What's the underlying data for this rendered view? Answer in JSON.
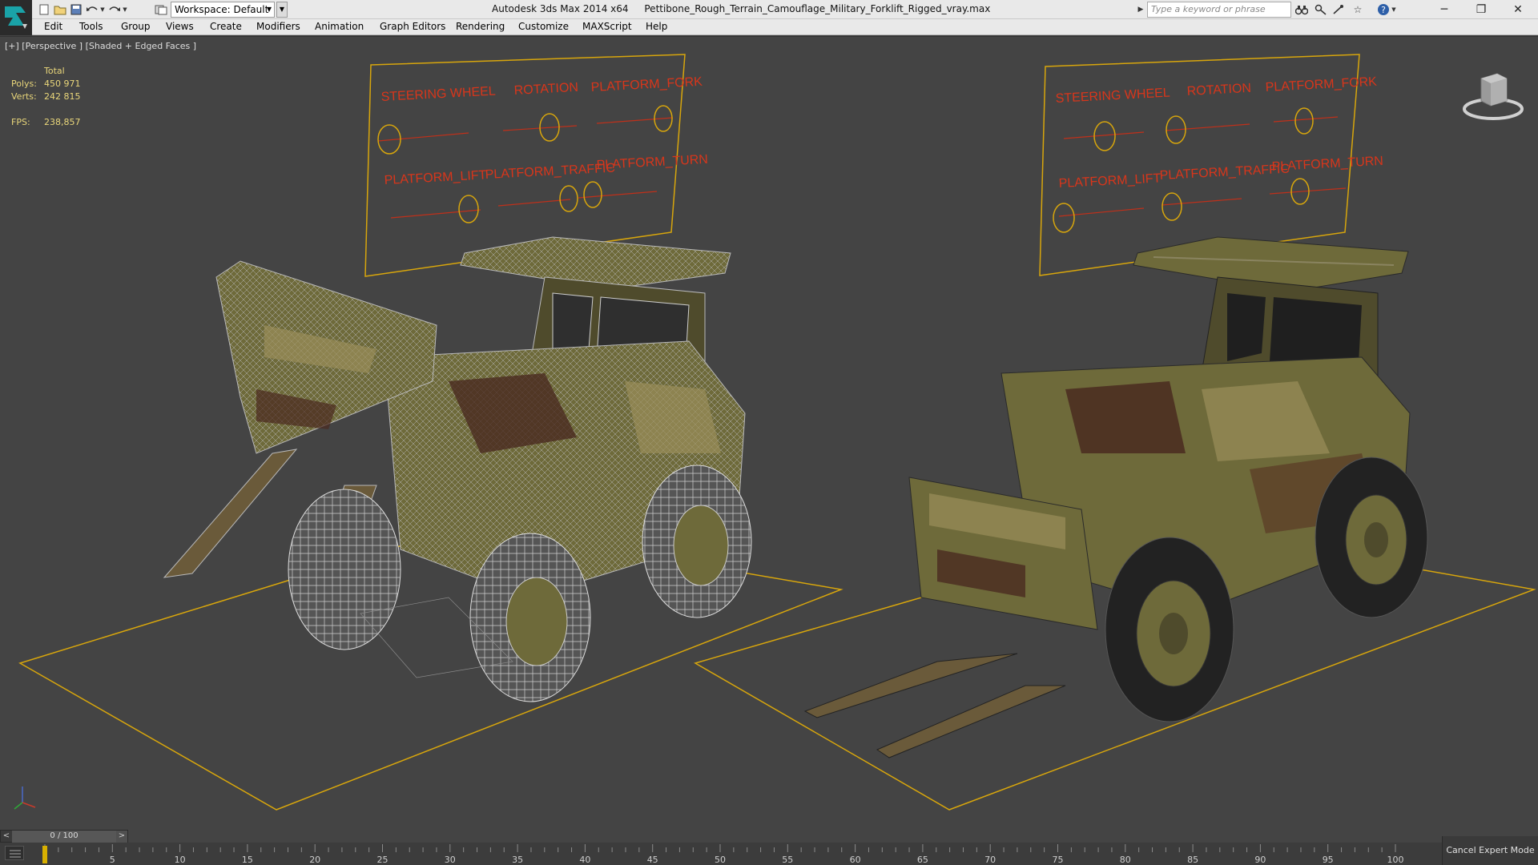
{
  "titlebar": {
    "workspace_label": "Workspace: Default",
    "app_name": "Autodesk 3ds Max  2014 x64",
    "file_name": "Pettibone_Rough_Terrain_Camouflage_Military_Forklift_Rigged_vray.max",
    "search_placeholder": "Type a keyword or phrase",
    "icons": [
      "new-icon",
      "open-icon",
      "save-icon",
      "undo-icon",
      "redo-icon",
      "project-icon",
      "binoculars-icon",
      "key-icon",
      "user-icon",
      "star-icon",
      "help-icon"
    ],
    "window_buttons": [
      "─",
      "❐",
      "✕"
    ]
  },
  "menu": {
    "items": [
      "Edit",
      "Tools",
      "Group",
      "Views",
      "Create",
      "Modifiers",
      "Animation",
      "Graph Editors",
      "Rendering",
      "Customize",
      "MAXScript",
      "Help"
    ]
  },
  "viewport": {
    "label": "[+] [Perspective ] [Shaded + Edged Faces ]",
    "stats": {
      "total_label": "Total",
      "polys_label": "Polys:",
      "polys_value": "450 971",
      "verts_label": "Verts:",
      "verts_value": "242 815",
      "fps_label": "FPS:",
      "fps_value": "238,857"
    },
    "rig_labels": [
      "STEERING WHEEL",
      "ROTATION",
      "PLATFORM_FORK",
      "PLATFORM_LIFT",
      "PLATFORM_TRAFFIC",
      "PLATFORM_TURN"
    ],
    "colors": {
      "background": "#444444",
      "grid_outline": "#d8a60c",
      "rig_text": "#d8361b",
      "wireframe": "#b9b9b9",
      "camo_olive": "#6e6a3a",
      "camo_tan": "#9a8e5a",
      "camo_brown": "#4a2a20"
    }
  },
  "timeline": {
    "frame_display": "0 / 100",
    "prev_label": "<",
    "next_label": ">",
    "ticks": [
      "0",
      "5",
      "10",
      "15",
      "20",
      "25",
      "30",
      "35",
      "40",
      "45",
      "50",
      "55",
      "60",
      "65",
      "70",
      "75",
      "80",
      "85",
      "90",
      "95",
      "100"
    ],
    "cancel_expert_mode": "Cancel Expert Mode"
  }
}
